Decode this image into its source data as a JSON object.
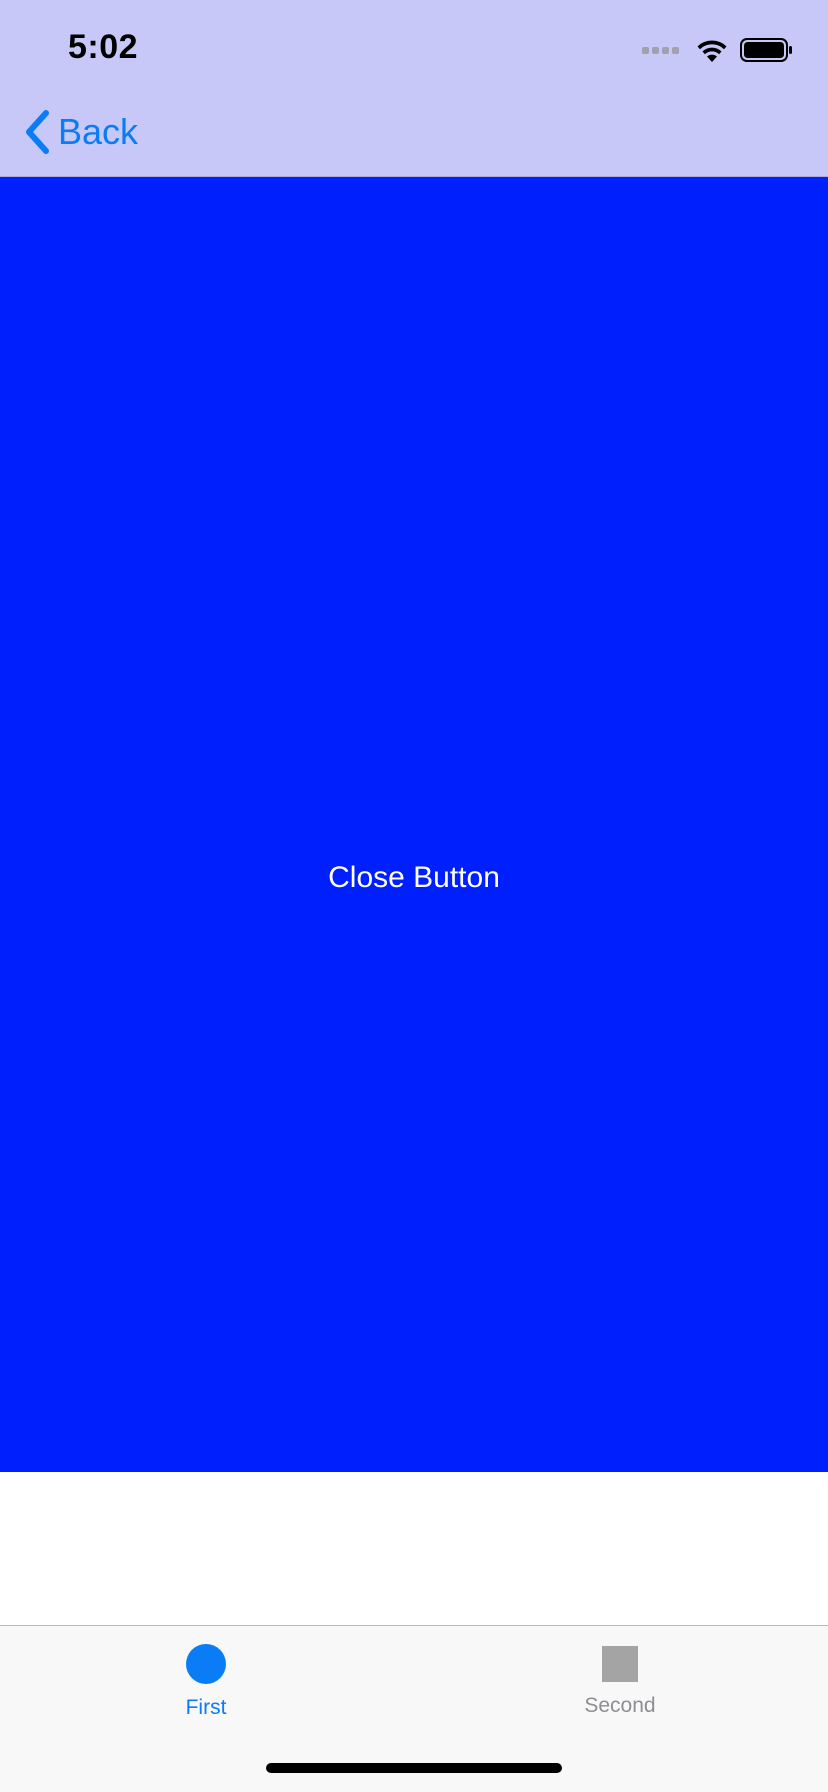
{
  "status_bar": {
    "time": "5:02"
  },
  "nav_bar": {
    "back_label": "Back"
  },
  "main": {
    "close_button_label": "Close Button"
  },
  "tab_bar": {
    "tabs": [
      {
        "label": "First",
        "icon": "circle-icon",
        "selected": true
      },
      {
        "label": "Second",
        "icon": "square-icon",
        "selected": false
      }
    ]
  },
  "colors": {
    "nav_background": "#c7c8f7",
    "panel_blue": "#001ffd",
    "accent": "#0a7cf5",
    "inactive_tab": "#8e8e93"
  }
}
